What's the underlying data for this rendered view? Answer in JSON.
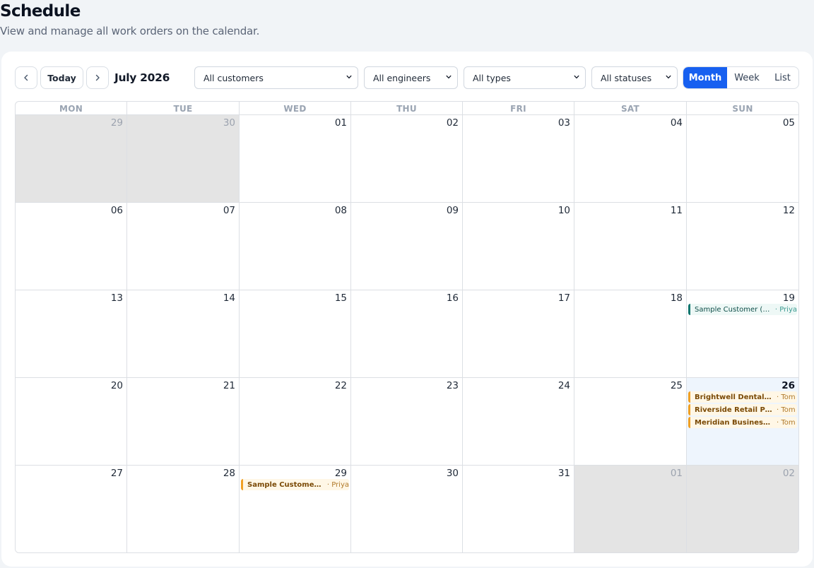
{
  "header": {
    "title": "Schedule",
    "subtitle": "View and manage all work orders on the calendar."
  },
  "toolbar": {
    "today_label": "Today",
    "month_label": "July 2026",
    "filters": {
      "customers": "All customers",
      "engineers": "All engineers",
      "types": "All types",
      "statuses": "All statuses"
    },
    "views": {
      "month": "Month",
      "week": "Week",
      "list": "List",
      "active": "Month"
    }
  },
  "calendar": {
    "weekdays": [
      "MON",
      "TUE",
      "WED",
      "THU",
      "FRI",
      "SAT",
      "SUN"
    ],
    "weeks": [
      [
        {
          "num": "29",
          "outside": true
        },
        {
          "num": "30",
          "outside": true
        },
        {
          "num": "01"
        },
        {
          "num": "02"
        },
        {
          "num": "03"
        },
        {
          "num": "04"
        },
        {
          "num": "05"
        }
      ],
      [
        {
          "num": "06"
        },
        {
          "num": "07"
        },
        {
          "num": "08"
        },
        {
          "num": "09"
        },
        {
          "num": "10"
        },
        {
          "num": "11"
        },
        {
          "num": "12"
        }
      ],
      [
        {
          "num": "13"
        },
        {
          "num": "14"
        },
        {
          "num": "15"
        },
        {
          "num": "16"
        },
        {
          "num": "17"
        },
        {
          "num": "18"
        },
        {
          "num": "19",
          "events": [
            {
              "title": "Sample Customer (D...",
              "engineer": "· Priya",
              "color": "teal"
            }
          ]
        }
      ],
      [
        {
          "num": "20"
        },
        {
          "num": "21"
        },
        {
          "num": "22"
        },
        {
          "num": "23"
        },
        {
          "num": "24"
        },
        {
          "num": "25"
        },
        {
          "num": "26",
          "today": true,
          "events": [
            {
              "title": "Brightwell Dental Pra...",
              "engineer": "· Tom",
              "color": "amber"
            },
            {
              "title": "Riverside Retail Park",
              "engineer": "· Tom",
              "color": "amber"
            },
            {
              "title": "Meridian Business Ce...",
              "engineer": "· Tom",
              "color": "amber"
            }
          ]
        }
      ],
      [
        {
          "num": "27"
        },
        {
          "num": "28"
        },
        {
          "num": "29",
          "events": [
            {
              "title": "Sample Customer (D...",
              "engineer": "· Priya",
              "color": "amber"
            }
          ]
        },
        {
          "num": "30"
        },
        {
          "num": "31"
        },
        {
          "num": "01",
          "outside": true
        },
        {
          "num": "02",
          "outside": true
        }
      ]
    ]
  },
  "colors": {
    "accent": "#1760f0",
    "event_amber": "#f0a024",
    "event_teal": "#0f766e",
    "outside_day": "#e4e4e4",
    "today_bg": "#eef5fd"
  }
}
